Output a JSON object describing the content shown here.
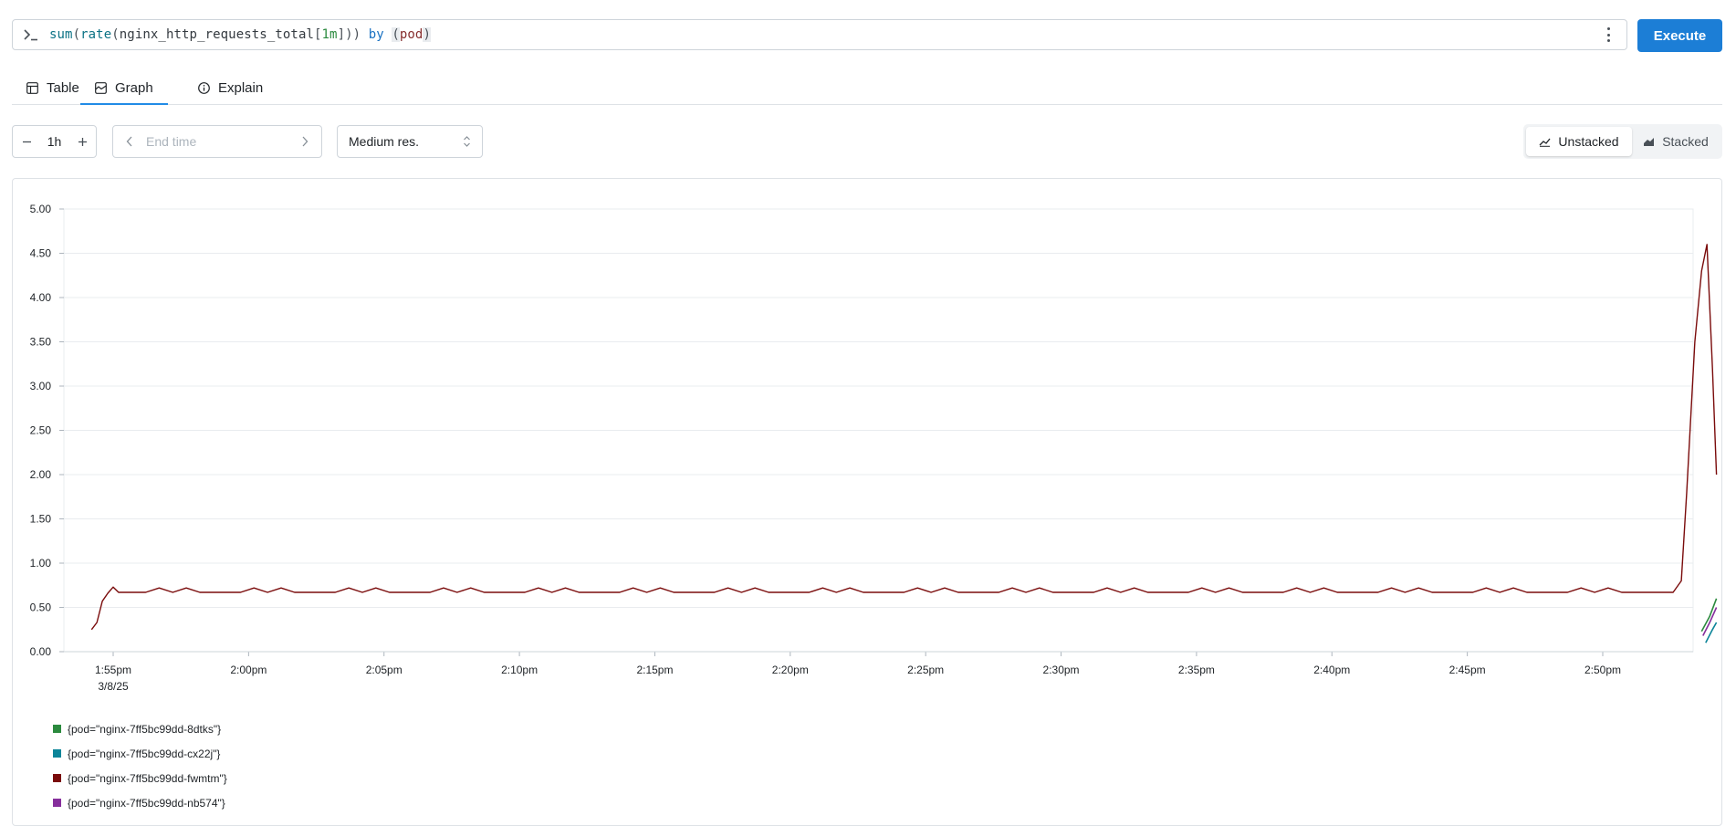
{
  "query": {
    "prompt_icon": "terminal-prompt-icon",
    "tokens": {
      "fn1": "sum",
      "p1": "(",
      "fn2": "rate",
      "p2": "(",
      "metric": "nginx_http_requests_total",
      "b1": "[",
      "range": "1m",
      "b2": "]",
      "p3": "))",
      "sp": " ",
      "kw": "by",
      "sp2": " ",
      "p4": "(",
      "label": "pod",
      "p5": ")"
    },
    "menu_icon": "kebab-menu-icon"
  },
  "execute_label": "Execute",
  "tabs": [
    {
      "label": "Table",
      "icon": "table-icon"
    },
    {
      "label": "Graph",
      "icon": "graph-icon",
      "active": true
    },
    {
      "label": "Explain",
      "icon": "info-icon"
    }
  ],
  "controls": {
    "range_value": "1h",
    "end_time_placeholder": "End time",
    "resolution": "Medium res.",
    "view_modes": [
      "Unstacked",
      "Stacked"
    ],
    "view_mode_selected": "Unstacked"
  },
  "colors": {
    "accent": "#1c7ed6",
    "tab_underline": "#228be6"
  },
  "chart_data": {
    "type": "line",
    "ylim": [
      0,
      5
    ],
    "y_ticks": [
      "0.00",
      "0.50",
      "1.00",
      "1.50",
      "2.00",
      "2.50",
      "3.00",
      "3.50",
      "4.00",
      "4.50",
      "5.00"
    ],
    "x_range_minutes": [
      -11.2,
      48.8
    ],
    "x_ticks": [
      {
        "minute": 0,
        "label": "1:55pm",
        "sublabel": "3/8/25"
      },
      {
        "minute": 5,
        "label": "2:00pm"
      },
      {
        "minute": 10,
        "label": "2:05pm"
      },
      {
        "minute": 15,
        "label": "2:10pm"
      },
      {
        "minute": 20,
        "label": "2:15pm"
      },
      {
        "minute": 25,
        "label": "2:20pm"
      },
      {
        "minute": 30,
        "label": "2:25pm"
      },
      {
        "minute": 35,
        "label": "2:30pm"
      },
      {
        "minute": 40,
        "label": "2:35pm"
      },
      {
        "minute": 45,
        "label": "2:40pm"
      },
      {
        "minute": 50,
        "label": "2:45pm"
      },
      {
        "minute": 55,
        "label": "2:50pm"
      }
    ],
    "grid": true,
    "series": [
      {
        "name": "{pod=\"nginx-7ff5bc99dd-8dtks\"}",
        "color": "#2b8a3e",
        "points": [
          [
            58.65,
            0.23
          ],
          [
            58.95,
            0.4
          ],
          [
            59.2,
            0.6
          ]
        ]
      },
      {
        "name": "{pod=\"nginx-7ff5bc99dd-cx22j\"}",
        "color": "#0c8599",
        "points": [
          [
            58.8,
            0.1
          ],
          [
            59.05,
            0.25
          ],
          [
            59.2,
            0.33
          ]
        ]
      },
      {
        "name": "{pod=\"nginx-7ff5bc99dd-fwmtm\"}",
        "color": "#7a0b0b",
        "base": 0.67,
        "zig_high": 0.72,
        "head": [
          [
            -0.8,
            0.25
          ],
          [
            -0.6,
            0.33
          ],
          [
            -0.4,
            0.57
          ],
          [
            -0.2,
            0.66
          ],
          [
            0.0,
            0.73
          ],
          [
            0.2,
            0.67
          ]
        ],
        "tail": [
          [
            57.6,
            0.67
          ],
          [
            57.9,
            0.8
          ],
          [
            58.1,
            1.8
          ],
          [
            58.4,
            3.5
          ],
          [
            58.65,
            4.3
          ],
          [
            58.85,
            4.6
          ],
          [
            59.05,
            3.2
          ],
          [
            59.2,
            2.0
          ]
        ],
        "zig_groups_start_minutes": [
          1.5,
          5.0,
          8.5,
          12.0,
          15.5,
          19.0,
          22.5,
          26.0,
          29.5,
          33.0,
          36.5,
          40.0,
          43.5,
          47.0,
          50.5,
          54.0,
          56.8
        ]
      },
      {
        "name": "{pod=\"nginx-7ff5bc99dd-nb574\"}",
        "color": "#862e9c",
        "points": [
          [
            58.7,
            0.18
          ],
          [
            58.95,
            0.33
          ],
          [
            59.2,
            0.5
          ]
        ]
      }
    ]
  }
}
